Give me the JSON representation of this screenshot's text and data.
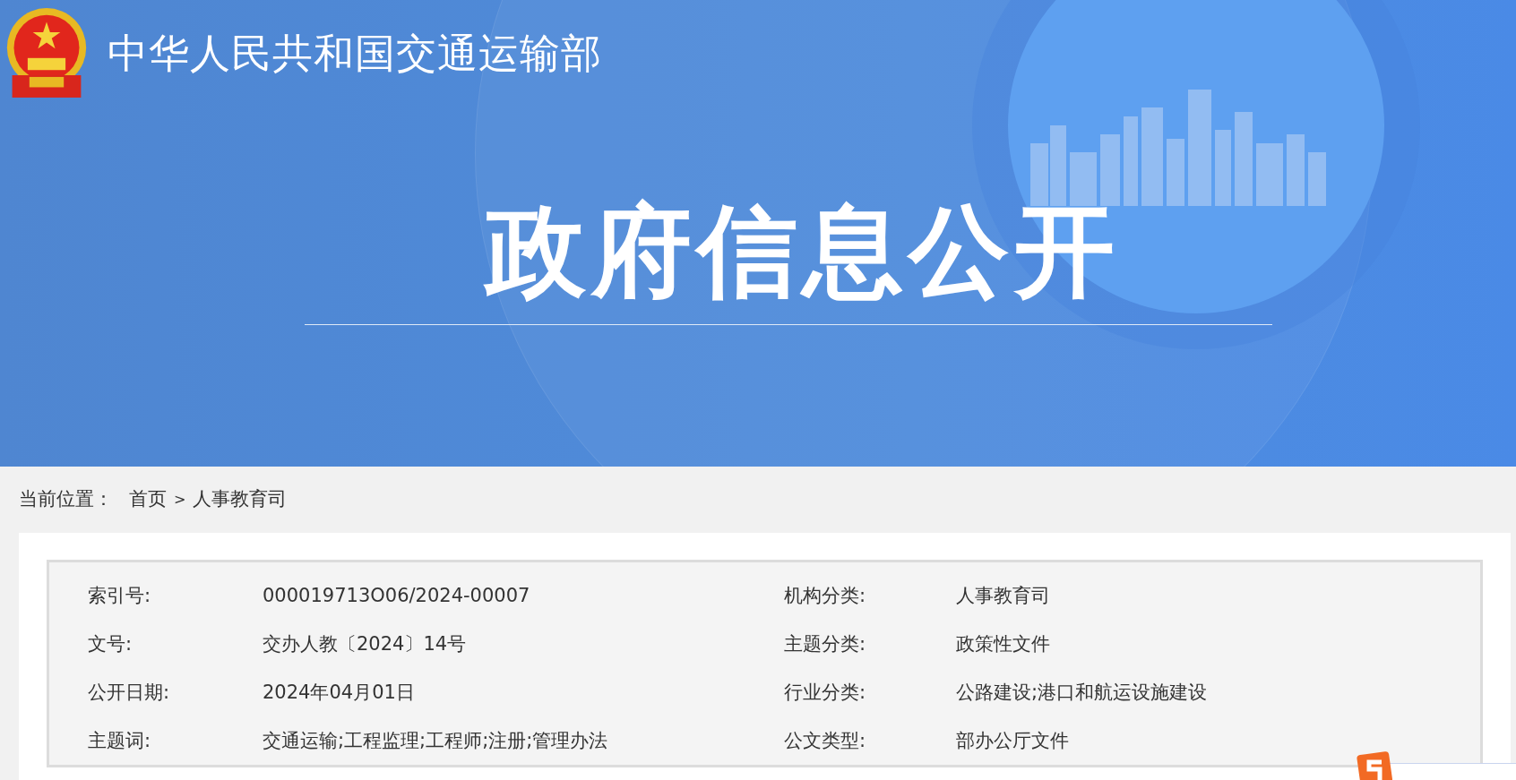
{
  "header": {
    "site_name": "中华人民共和国交通运输部",
    "banner_title": "政府信息公开"
  },
  "breadcrumb": {
    "label": "当前位置：",
    "items": [
      {
        "text": "首页"
      },
      {
        "text": "人事教育司"
      }
    ],
    "separator": ">"
  },
  "info_table": {
    "rows": [
      {
        "left_label": "索引号:",
        "left_value": "000019713O06/2024-00007",
        "right_label": "机构分类:",
        "right_value": "人事教育司"
      },
      {
        "left_label": "文号:",
        "left_value": "交办人教〔2024〕14号",
        "right_label": "主题分类:",
        "right_value": "政策性文件"
      },
      {
        "left_label": "公开日期:",
        "left_value": "2024年04月01日",
        "right_label": "行业分类:",
        "right_value": "公路建设;港口和航运设施建设"
      },
      {
        "left_label": "主题词:",
        "left_value": "交通运输;工程监理;工程师;注册;管理办法",
        "right_label": "公文类型:",
        "right_value": "部办公厅文件"
      }
    ]
  }
}
